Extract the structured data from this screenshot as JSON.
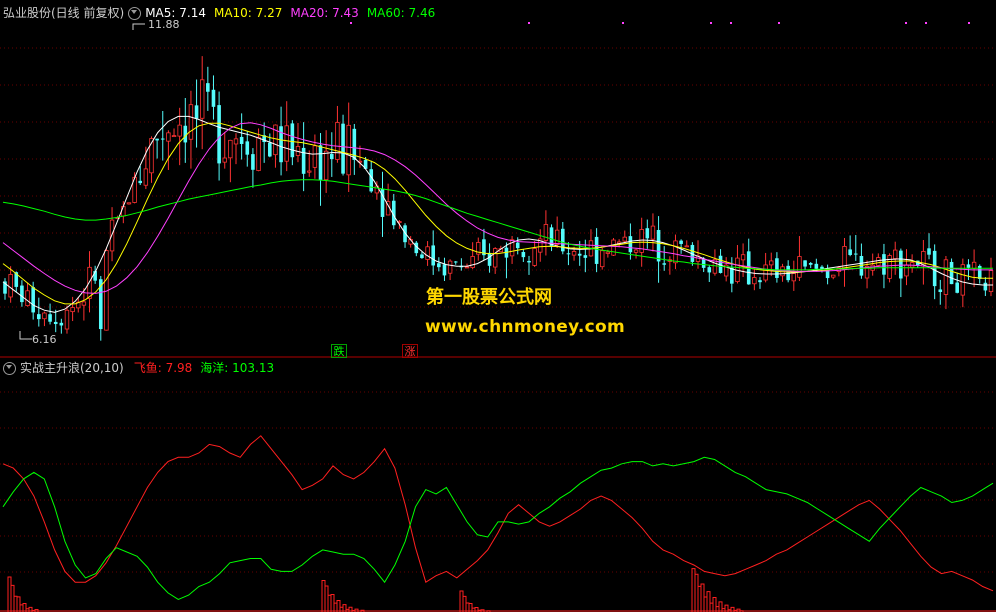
{
  "stock_title": "弘业股份(日线 前复权)",
  "ma_legend": [
    {
      "name": "MA5",
      "label": "MA5: 7.14",
      "color": "#ffffff"
    },
    {
      "name": "MA10",
      "label": "MA10: 7.27",
      "color": "#ffff00"
    },
    {
      "name": "MA20",
      "label": "MA20: 7.43",
      "color": "#ff40ff"
    },
    {
      "name": "MA60",
      "label": "MA60: 7.46",
      "color": "#00ff00"
    }
  ],
  "indicator_title": "实战主升浪(20,10)",
  "indicator_legend": [
    {
      "name": "飞鱼",
      "label": "飞鱼: 7.98",
      "color": "#ff2020"
    },
    {
      "name": "海洋",
      "label": "海洋: 103.13",
      "color": "#00ff00"
    }
  ],
  "high_label": "11.88",
  "low_label": "6.16",
  "watermark_line1": "第一股票公式网",
  "watermark_line2": "www.chnmoney.com",
  "marker_die": "跌",
  "marker_zhang": "涨",
  "colors": {
    "up": "#ff3232",
    "down": "#54fcfc",
    "grid": "#8b0000"
  },
  "chart_data": {
    "type": "candlestick",
    "price_range": [
      6.16,
      11.88
    ],
    "price_series": [
      {
        "name": "MA5",
        "values": [
          7.2,
          7.05,
          6.9,
          6.75,
          6.66,
          6.62,
          6.68,
          6.83,
          7.07,
          7.41,
          7.83,
          8.31,
          8.81,
          9.3,
          9.72,
          10.05,
          10.26,
          10.36,
          10.36,
          10.3,
          10.22,
          10.15,
          10.1,
          10.05,
          10.0,
          9.93,
          9.86,
          9.78,
          9.72,
          9.67,
          9.64,
          9.65,
          9.67,
          9.66,
          9.58,
          9.4,
          9.12,
          8.78,
          8.43,
          8.13,
          7.89,
          7.72,
          7.6,
          7.53,
          7.5,
          7.5,
          7.55,
          7.65,
          7.79,
          7.92,
          8.0,
          8.02,
          7.99,
          7.93,
          7.87,
          7.83,
          7.82,
          7.83,
          7.86,
          7.9,
          7.94,
          7.98,
          8.0,
          7.99,
          7.95,
          7.89,
          7.81,
          7.72,
          7.64,
          7.56,
          7.49,
          7.43,
          7.39,
          7.36,
          7.35,
          7.35,
          7.36,
          7.38,
          7.4,
          7.43,
          7.46,
          7.49,
          7.52,
          7.55,
          7.58,
          7.61,
          7.63,
          7.64,
          7.62,
          7.55,
          7.46,
          7.36,
          7.27,
          7.2,
          7.16,
          7.14,
          7.14
        ]
      },
      {
        "name": "MA10",
        "values": [
          7.55,
          7.4,
          7.24,
          7.08,
          6.95,
          6.84,
          6.78,
          6.78,
          6.86,
          7.01,
          7.24,
          7.55,
          7.93,
          8.35,
          8.78,
          9.19,
          9.55,
          9.84,
          10.05,
          10.18,
          10.23,
          10.23,
          10.18,
          10.12,
          10.06,
          10.0,
          9.95,
          9.91,
          9.88,
          9.86,
          9.82,
          9.77,
          9.72,
          9.67,
          9.62,
          9.56,
          9.48,
          9.35,
          9.17,
          8.95,
          8.71,
          8.47,
          8.26,
          8.08,
          7.94,
          7.84,
          7.77,
          7.74,
          7.74,
          7.77,
          7.81,
          7.84,
          7.87,
          7.88,
          7.87,
          7.85,
          7.84,
          7.84,
          7.86,
          7.89,
          7.92,
          7.95,
          7.96,
          7.95,
          7.93,
          7.89,
          7.84,
          7.78,
          7.72,
          7.65,
          7.59,
          7.53,
          7.48,
          7.44,
          7.42,
          7.4,
          7.39,
          7.39,
          7.4,
          7.41,
          7.43,
          7.45,
          7.48,
          7.51,
          7.54,
          7.57,
          7.59,
          7.6,
          7.6,
          7.57,
          7.53,
          7.47,
          7.4,
          7.34,
          7.29,
          7.27,
          7.27
        ]
      },
      {
        "name": "MA20",
        "values": [
          7.95,
          7.8,
          7.65,
          7.5,
          7.36,
          7.23,
          7.12,
          7.04,
          6.99,
          6.98,
          7.02,
          7.12,
          7.28,
          7.49,
          7.76,
          8.07,
          8.41,
          8.77,
          9.12,
          9.45,
          9.74,
          9.97,
          10.13,
          10.22,
          10.24,
          10.2,
          10.13,
          10.05,
          9.98,
          9.92,
          9.87,
          9.83,
          9.8,
          9.78,
          9.76,
          9.74,
          9.7,
          9.63,
          9.53,
          9.4,
          9.24,
          9.06,
          8.87,
          8.68,
          8.51,
          8.36,
          8.23,
          8.13,
          8.05,
          8.0,
          7.97,
          7.96,
          7.95,
          7.94,
          7.93,
          7.92,
          7.91,
          7.9,
          7.89,
          7.88,
          7.87,
          7.85,
          7.83,
          7.8,
          7.77,
          7.74,
          7.7,
          7.67,
          7.63,
          7.6,
          7.56,
          7.53,
          7.5,
          7.47,
          7.44,
          7.42,
          7.41,
          7.4,
          7.4,
          7.4,
          7.41,
          7.42,
          7.44,
          7.46,
          7.48,
          7.5,
          7.51,
          7.52,
          7.52,
          7.51,
          7.49,
          7.47,
          7.45,
          7.44,
          7.43,
          7.43,
          7.43
        ]
      },
      {
        "name": "MA60",
        "values": [
          8.72,
          8.69,
          8.65,
          8.6,
          8.55,
          8.49,
          8.44,
          8.4,
          8.38,
          8.38,
          8.4,
          8.43,
          8.47,
          8.52,
          8.57,
          8.63,
          8.68,
          8.73,
          8.78,
          8.82,
          8.86,
          8.9,
          8.94,
          8.98,
          9.02,
          9.05,
          9.09,
          9.12,
          9.14,
          9.15,
          9.15,
          9.14,
          9.12,
          9.09,
          9.06,
          9.03,
          9.0,
          8.97,
          8.94,
          8.9,
          8.85,
          8.79,
          8.72,
          8.65,
          8.58,
          8.51,
          8.45,
          8.39,
          8.33,
          8.27,
          8.21,
          8.15,
          8.09,
          8.03,
          7.97,
          7.92,
          7.88,
          7.84,
          7.81,
          7.78,
          7.75,
          7.72,
          7.69,
          7.66,
          7.63,
          7.6,
          7.58,
          7.55,
          7.53,
          7.51,
          7.49,
          7.48,
          7.46,
          7.45,
          7.44,
          7.43,
          7.43,
          7.43,
          7.43,
          7.44,
          7.44,
          7.45,
          7.45,
          7.46,
          7.46,
          7.47,
          7.47,
          7.47,
          7.47,
          7.47,
          7.47,
          7.46,
          7.46,
          7.46,
          7.46,
          7.46,
          7.46
        ]
      }
    ],
    "indicator_series": [
      {
        "name": "飞鱼",
        "values": [
          67,
          65,
          60,
          52,
          40,
          27,
          17,
          12,
          12,
          15,
          21,
          29,
          38,
          47,
          56,
          63,
          68,
          70,
          70,
          72,
          76,
          75,
          72,
          70,
          76,
          80,
          74,
          68,
          62,
          55,
          57,
          60,
          66,
          62,
          60,
          63,
          68,
          74,
          65,
          48,
          28,
          12,
          15,
          17,
          14,
          18,
          22,
          27,
          35,
          44,
          48,
          44,
          40,
          38,
          40,
          43,
          46,
          50,
          52,
          50,
          46,
          42,
          37,
          31,
          27,
          25,
          22,
          20,
          17,
          16,
          15,
          16,
          18,
          20,
          22,
          25,
          27,
          30,
          33,
          36,
          39,
          42,
          45,
          48,
          50,
          46,
          41,
          36,
          30,
          24,
          19,
          16,
          17,
          15,
          13,
          10,
          8
        ]
      },
      {
        "name": "海洋",
        "values": [
          47,
          54,
          60,
          63,
          60,
          47,
          31,
          20,
          14,
          16,
          23,
          28,
          26,
          24,
          19,
          12,
          7,
          4,
          6,
          10,
          12,
          16,
          21,
          22,
          23,
          23,
          18,
          17,
          17,
          20,
          24,
          27,
          26,
          25,
          25,
          23,
          18,
          12,
          20,
          31,
          47,
          55,
          53,
          56,
          48,
          40,
          34,
          33,
          40,
          40,
          39,
          40,
          44,
          47,
          51,
          54,
          58,
          61,
          64,
          65,
          67,
          68,
          68,
          66,
          67,
          66,
          67,
          68,
          70,
          69,
          66,
          63,
          61,
          58,
          55,
          54,
          53,
          51,
          49,
          46,
          43,
          40,
          37,
          34,
          31,
          37,
          42,
          47,
          52,
          56,
          54,
          52,
          49,
          50,
          52,
          55,
          58
        ]
      }
    ]
  }
}
